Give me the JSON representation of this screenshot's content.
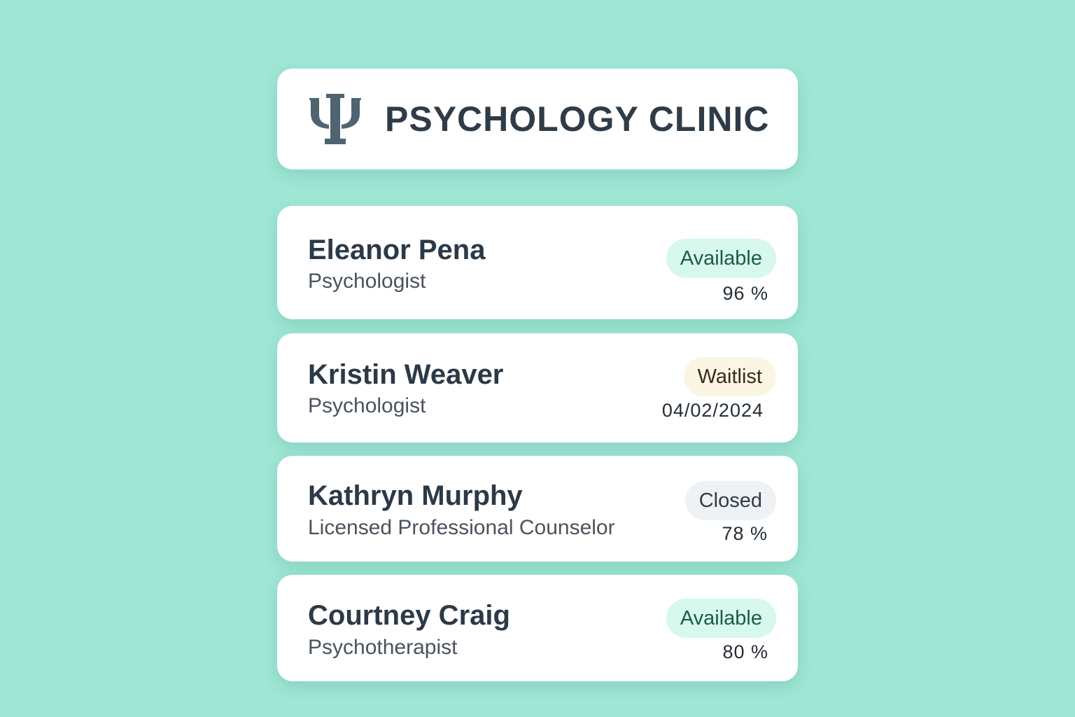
{
  "header": {
    "logo_icon": "psi-icon",
    "title": "PSYCHOLOGY CLINIC"
  },
  "colors": {
    "background": "#9fe6d5",
    "card": "#ffffff",
    "available_badge_bg": "#d6f8ee",
    "available_badge_text": "#1d5b45",
    "waitlist_badge_bg": "#fbf6e4",
    "waitlist_badge_text": "#3a2a18",
    "closed_badge_bg": "#eef2f5",
    "closed_badge_text": "#2f3b46"
  },
  "providers": [
    {
      "name": "Eleanor Pena",
      "role": "Psychologist",
      "status": "Available",
      "metric": "96 %"
    },
    {
      "name": "Kristin Weaver",
      "role": "Psychologist",
      "status": "Waitlist",
      "metric": "04/02/2024"
    },
    {
      "name": "Kathryn Murphy",
      "role": "Licensed Professional Counselor",
      "status": "Closed",
      "metric": "78 %"
    },
    {
      "name": "Courtney Craig",
      "role": "Psychotherapist",
      "status": "Available",
      "metric": "80 %"
    }
  ]
}
